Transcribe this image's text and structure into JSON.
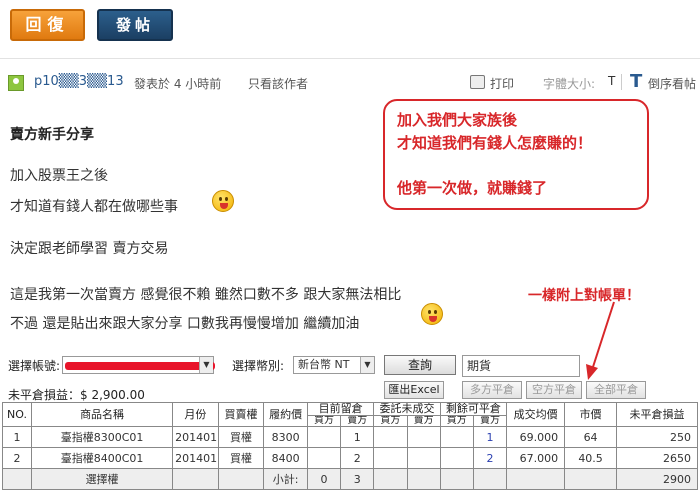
{
  "toolbar": {
    "reply_label": "回復",
    "post_label": "發帖"
  },
  "meta": {
    "username": "p10▒▒3▒▒13",
    "posted": "發表於 4 小時前",
    "author_only": "只看該作者",
    "print": "打印",
    "font_size_label": "字體大小:",
    "font_small": "T",
    "font_big": "T",
    "order": "倒序看帖"
  },
  "post": {
    "title": "賣方新手分享",
    "lines": [
      "加入股票王之後",
      "才知道有錢人都在做哪些事",
      "決定跟老師學習  賣方交易",
      "這是我第一次當賣方  感覺很不賴  雖然口數不多  跟大家無法相比",
      "不過  還是貼出來跟大家分享  口數我再慢慢增加  繼續加油"
    ]
  },
  "callout": {
    "line1": "加入我們大家族後",
    "line2": "才知道我們有錢人怎麼賺的！",
    "line3": "他第一次做，就賺錢了"
  },
  "annotation": "一樣附上對帳單！",
  "statement": {
    "account_label": "選擇帳號:",
    "currency_label": "選擇幣別:",
    "currency_value": "新台幣 NT",
    "query_label": "查詢",
    "product_value": "期貨",
    "unrealized_label": "未平倉損益：$ 2,900.00",
    "buttons": {
      "export": "匯出Excel",
      "long_close": "多方平倉",
      "short_close": "空方平倉",
      "close_all": "全部平倉"
    },
    "headers": {
      "no": "NO.",
      "name": "商品名稱",
      "month": "月份",
      "buysell": "買賣權",
      "strike": "履約價",
      "open_today": "目前留倉",
      "pending": "委託未成交",
      "closable": "剩餘可平倉",
      "avg_price": "成交均價",
      "market": "市價",
      "pnl": "未平倉損益",
      "buy": "買方",
      "sell": "賣方"
    },
    "rows": [
      {
        "no": "1",
        "name": "臺指權8300C01",
        "month": "201401",
        "buysell": "買權",
        "strike": "8300",
        "open_buy": "",
        "open_sell": "1",
        "pend_buy": "",
        "pend_sell": "",
        "close_buy": "",
        "close_sell": "1",
        "avg": "69.000",
        "market": "64",
        "pnl": "250"
      },
      {
        "no": "2",
        "name": "臺指權8400C01",
        "month": "201401",
        "buysell": "買權",
        "strike": "8400",
        "open_buy": "",
        "open_sell": "2",
        "pend_buy": "",
        "pend_sell": "",
        "close_buy": "",
        "close_sell": "2",
        "avg": "67.000",
        "market": "40.5",
        "pnl": "2650"
      }
    ],
    "total": {
      "name": "選擇權",
      "subtotal_label": "小計:",
      "open_buy": "0",
      "open_sell": "3",
      "pnl": "2900"
    }
  }
}
